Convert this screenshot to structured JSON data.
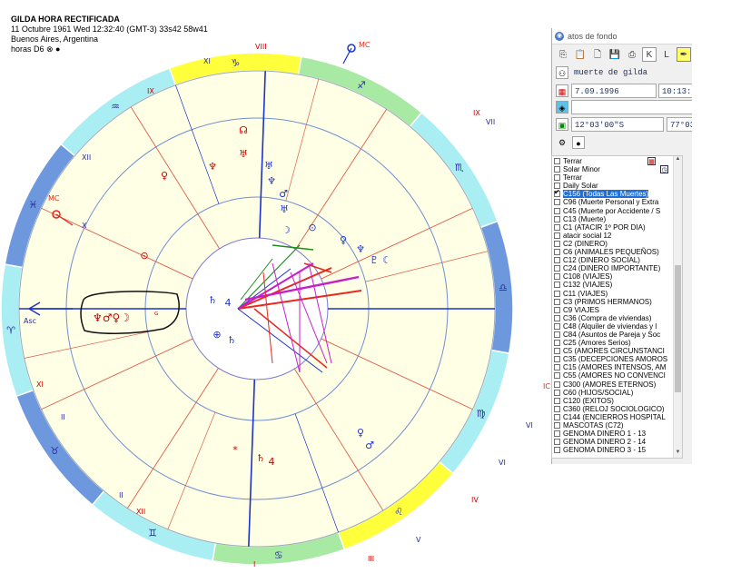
{
  "header": {
    "title": "GILDA HORA RECTIFICADA",
    "line1": "11 Octubre 1961  Wed  12:32:40 (GMT-3) 33s42  58w41",
    "line2": "Buenos Aires, Argentina",
    "line3": "horas D6 ⊗ ●"
  },
  "chart": {
    "angle_labels": {
      "asc": "Asc",
      "mc_left": "MC",
      "mc_top": "MC",
      "ic": "IC"
    },
    "house_numerals": [
      "VIII",
      "IX",
      "XI",
      "XII",
      "X",
      "XI",
      "II",
      "XII",
      "II",
      "I",
      "III",
      "V",
      "VI",
      "VI",
      "IV",
      "IX",
      "VII"
    ],
    "inner_numerals": [
      "I",
      "II",
      "III",
      "IV",
      "V",
      "VI",
      "VII",
      "VIII",
      "IX",
      "X",
      "XI",
      "XII"
    ],
    "zodiac_glyphs": [
      "♈",
      "♉",
      "♊",
      "♋",
      "♌",
      "♍",
      "♎",
      "♏",
      "♐",
      "♑",
      "♒",
      "♓"
    ],
    "annotation_planets": "♆♂♀☽",
    "colors": {
      "wheel_light_blue": "#a9eef2",
      "wheel_blue": "#6d98de",
      "wheel_green": "#a8eaa4",
      "wheel_yellow": "#ffff3c",
      "inner_fill": "#ffffe6",
      "red": "#e8281e",
      "blue": "#1e32c8"
    }
  },
  "panel": {
    "title": "atos de fondo",
    "toolbar": [
      "copy-icon",
      "paste-icon",
      "new-icon",
      "save-icon",
      "print-icon",
      "K",
      "L",
      "pen-icon"
    ],
    "name_value": "muerte de gilda",
    "date_value": "7.09.1996",
    "time_value": "10:13:30",
    "lat_value": "12°03'00\"S",
    "lon_value": "77°03'",
    "list": [
      {
        "label": "Terrar",
        "checked": false,
        "sel": false
      },
      {
        "label": "Solar Minor",
        "checked": false,
        "sel": false
      },
      {
        "label": "Terrar",
        "checked": false,
        "sel": false
      },
      {
        "label": "Daily Solar",
        "checked": false,
        "sel": false
      },
      {
        "label": "C156 (Todas Las Muertes)",
        "checked": true,
        "sel": true
      },
      {
        "label": "C96 (Muerte Personal y Extra",
        "checked": false,
        "sel": false
      },
      {
        "label": "C45 (Muerte por Accidente / S",
        "checked": false,
        "sel": false
      },
      {
        "label": "C13 (Muerte)",
        "checked": false,
        "sel": false
      },
      {
        "label": "C1 (ATACIR 1º POR DIA)",
        "checked": false,
        "sel": false
      },
      {
        "label": "atacir social 12",
        "checked": false,
        "sel": false
      },
      {
        "label": "C2 (DINERO)",
        "checked": false,
        "sel": false
      },
      {
        "label": "C6 (ANIMALES PEQUEÑOS)",
        "checked": false,
        "sel": false
      },
      {
        "label": "C12 (DINERO SOCIAL)",
        "checked": false,
        "sel": false
      },
      {
        "label": "C24 (DINERO IMPORTANTE)",
        "checked": false,
        "sel": false
      },
      {
        "label": "C108 (VIAJES)",
        "checked": false,
        "sel": false
      },
      {
        "label": "C132 (VIAJES)",
        "checked": false,
        "sel": false
      },
      {
        "label": "C11 (VIAJES)",
        "checked": false,
        "sel": false
      },
      {
        "label": "C3 (PRIMOS HERMANOS)",
        "checked": false,
        "sel": false
      },
      {
        "label": "C9 VIAJES",
        "checked": false,
        "sel": false
      },
      {
        "label": "C36 (Compra de viviendas)",
        "checked": false,
        "sel": false
      },
      {
        "label": "C48 (Alquiler de viviendas y l",
        "checked": false,
        "sel": false
      },
      {
        "label": "C84 (Asuntos de Pareja y Soc",
        "checked": false,
        "sel": false
      },
      {
        "label": "C25 (Amores Serios)",
        "checked": false,
        "sel": false
      },
      {
        "label": "C5 (AMORES CIRCUNSTANCI",
        "checked": false,
        "sel": false
      },
      {
        "label": "C35 (DECEPCIONES AMOROS",
        "checked": false,
        "sel": false
      },
      {
        "label": "C15 (AMORES INTENSOS, AM",
        "checked": false,
        "sel": false
      },
      {
        "label": "C55 (AMORES NO CONVENCI",
        "checked": false,
        "sel": false
      },
      {
        "label": "C300 (AMORES ETERNOS)",
        "checked": false,
        "sel": false
      },
      {
        "label": "C60 (HIJOS/SOCIAL)",
        "checked": false,
        "sel": false
      },
      {
        "label": "C120 (EXITOS)",
        "checked": false,
        "sel": false
      },
      {
        "label": "C360 (RELOJ SOCIOLOGICO)",
        "checked": false,
        "sel": false
      },
      {
        "label": "C144 (ENCIERROS HOSPITAL",
        "checked": false,
        "sel": false
      },
      {
        "label": "MASCOTAS (C72)",
        "checked": false,
        "sel": false
      },
      {
        "label": "GENOMA DINERO 1 - 13",
        "checked": false,
        "sel": false
      },
      {
        "label": "GENOMA DINERO 2 - 14",
        "checked": false,
        "sel": false
      },
      {
        "label": "GENOMA DINERO 3 - 15",
        "checked": false,
        "sel": false
      }
    ]
  }
}
